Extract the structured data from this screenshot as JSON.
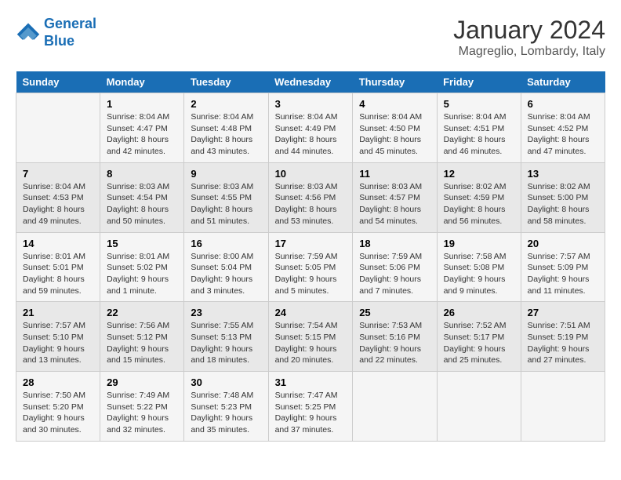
{
  "logo": {
    "line1": "General",
    "line2": "Blue"
  },
  "title": "January 2024",
  "subtitle": "Magreglio, Lombardy, Italy",
  "days_of_week": [
    "Sunday",
    "Monday",
    "Tuesday",
    "Wednesday",
    "Thursday",
    "Friday",
    "Saturday"
  ],
  "weeks": [
    [
      {
        "day": "",
        "sunrise": "",
        "sunset": "",
        "daylight": ""
      },
      {
        "day": "1",
        "sunrise": "Sunrise: 8:04 AM",
        "sunset": "Sunset: 4:47 PM",
        "daylight": "Daylight: 8 hours and 42 minutes."
      },
      {
        "day": "2",
        "sunrise": "Sunrise: 8:04 AM",
        "sunset": "Sunset: 4:48 PM",
        "daylight": "Daylight: 8 hours and 43 minutes."
      },
      {
        "day": "3",
        "sunrise": "Sunrise: 8:04 AM",
        "sunset": "Sunset: 4:49 PM",
        "daylight": "Daylight: 8 hours and 44 minutes."
      },
      {
        "day": "4",
        "sunrise": "Sunrise: 8:04 AM",
        "sunset": "Sunset: 4:50 PM",
        "daylight": "Daylight: 8 hours and 45 minutes."
      },
      {
        "day": "5",
        "sunrise": "Sunrise: 8:04 AM",
        "sunset": "Sunset: 4:51 PM",
        "daylight": "Daylight: 8 hours and 46 minutes."
      },
      {
        "day": "6",
        "sunrise": "Sunrise: 8:04 AM",
        "sunset": "Sunset: 4:52 PM",
        "daylight": "Daylight: 8 hours and 47 minutes."
      }
    ],
    [
      {
        "day": "7",
        "sunrise": "Sunrise: 8:04 AM",
        "sunset": "Sunset: 4:53 PM",
        "daylight": "Daylight: 8 hours and 49 minutes."
      },
      {
        "day": "8",
        "sunrise": "Sunrise: 8:03 AM",
        "sunset": "Sunset: 4:54 PM",
        "daylight": "Daylight: 8 hours and 50 minutes."
      },
      {
        "day": "9",
        "sunrise": "Sunrise: 8:03 AM",
        "sunset": "Sunset: 4:55 PM",
        "daylight": "Daylight: 8 hours and 51 minutes."
      },
      {
        "day": "10",
        "sunrise": "Sunrise: 8:03 AM",
        "sunset": "Sunset: 4:56 PM",
        "daylight": "Daylight: 8 hours and 53 minutes."
      },
      {
        "day": "11",
        "sunrise": "Sunrise: 8:03 AM",
        "sunset": "Sunset: 4:57 PM",
        "daylight": "Daylight: 8 hours and 54 minutes."
      },
      {
        "day": "12",
        "sunrise": "Sunrise: 8:02 AM",
        "sunset": "Sunset: 4:59 PM",
        "daylight": "Daylight: 8 hours and 56 minutes."
      },
      {
        "day": "13",
        "sunrise": "Sunrise: 8:02 AM",
        "sunset": "Sunset: 5:00 PM",
        "daylight": "Daylight: 8 hours and 58 minutes."
      }
    ],
    [
      {
        "day": "14",
        "sunrise": "Sunrise: 8:01 AM",
        "sunset": "Sunset: 5:01 PM",
        "daylight": "Daylight: 8 hours and 59 minutes."
      },
      {
        "day": "15",
        "sunrise": "Sunrise: 8:01 AM",
        "sunset": "Sunset: 5:02 PM",
        "daylight": "Daylight: 9 hours and 1 minute."
      },
      {
        "day": "16",
        "sunrise": "Sunrise: 8:00 AM",
        "sunset": "Sunset: 5:04 PM",
        "daylight": "Daylight: 9 hours and 3 minutes."
      },
      {
        "day": "17",
        "sunrise": "Sunrise: 7:59 AM",
        "sunset": "Sunset: 5:05 PM",
        "daylight": "Daylight: 9 hours and 5 minutes."
      },
      {
        "day": "18",
        "sunrise": "Sunrise: 7:59 AM",
        "sunset": "Sunset: 5:06 PM",
        "daylight": "Daylight: 9 hours and 7 minutes."
      },
      {
        "day": "19",
        "sunrise": "Sunrise: 7:58 AM",
        "sunset": "Sunset: 5:08 PM",
        "daylight": "Daylight: 9 hours and 9 minutes."
      },
      {
        "day": "20",
        "sunrise": "Sunrise: 7:57 AM",
        "sunset": "Sunset: 5:09 PM",
        "daylight": "Daylight: 9 hours and 11 minutes."
      }
    ],
    [
      {
        "day": "21",
        "sunrise": "Sunrise: 7:57 AM",
        "sunset": "Sunset: 5:10 PM",
        "daylight": "Daylight: 9 hours and 13 minutes."
      },
      {
        "day": "22",
        "sunrise": "Sunrise: 7:56 AM",
        "sunset": "Sunset: 5:12 PM",
        "daylight": "Daylight: 9 hours and 15 minutes."
      },
      {
        "day": "23",
        "sunrise": "Sunrise: 7:55 AM",
        "sunset": "Sunset: 5:13 PM",
        "daylight": "Daylight: 9 hours and 18 minutes."
      },
      {
        "day": "24",
        "sunrise": "Sunrise: 7:54 AM",
        "sunset": "Sunset: 5:15 PM",
        "daylight": "Daylight: 9 hours and 20 minutes."
      },
      {
        "day": "25",
        "sunrise": "Sunrise: 7:53 AM",
        "sunset": "Sunset: 5:16 PM",
        "daylight": "Daylight: 9 hours and 22 minutes."
      },
      {
        "day": "26",
        "sunrise": "Sunrise: 7:52 AM",
        "sunset": "Sunset: 5:17 PM",
        "daylight": "Daylight: 9 hours and 25 minutes."
      },
      {
        "day": "27",
        "sunrise": "Sunrise: 7:51 AM",
        "sunset": "Sunset: 5:19 PM",
        "daylight": "Daylight: 9 hours and 27 minutes."
      }
    ],
    [
      {
        "day": "28",
        "sunrise": "Sunrise: 7:50 AM",
        "sunset": "Sunset: 5:20 PM",
        "daylight": "Daylight: 9 hours and 30 minutes."
      },
      {
        "day": "29",
        "sunrise": "Sunrise: 7:49 AM",
        "sunset": "Sunset: 5:22 PM",
        "daylight": "Daylight: 9 hours and 32 minutes."
      },
      {
        "day": "30",
        "sunrise": "Sunrise: 7:48 AM",
        "sunset": "Sunset: 5:23 PM",
        "daylight": "Daylight: 9 hours and 35 minutes."
      },
      {
        "day": "31",
        "sunrise": "Sunrise: 7:47 AM",
        "sunset": "Sunset: 5:25 PM",
        "daylight": "Daylight: 9 hours and 37 minutes."
      },
      {
        "day": "",
        "sunrise": "",
        "sunset": "",
        "daylight": ""
      },
      {
        "day": "",
        "sunrise": "",
        "sunset": "",
        "daylight": ""
      },
      {
        "day": "",
        "sunrise": "",
        "sunset": "",
        "daylight": ""
      }
    ]
  ]
}
